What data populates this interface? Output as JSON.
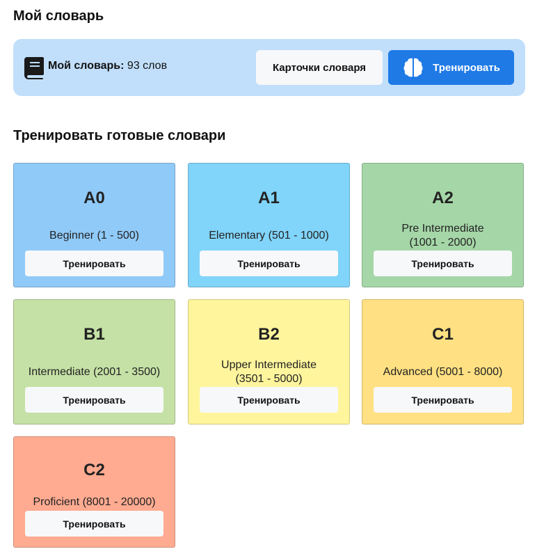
{
  "title": "Мой словарь",
  "my_dictionary": {
    "label_bold": "Мой словарь:",
    "count_text": "93 слов",
    "cards_button": "Карточки словаря",
    "train_button": "Тренировать"
  },
  "section_title": "Тренировать готовые словари",
  "levels": [
    {
      "code": "A0",
      "desc": "Beginner (1 - 500)",
      "button": "Тренировать",
      "color": "#90caf9"
    },
    {
      "code": "A1",
      "desc": "Elementary (501 - 1000)",
      "button": "Тренировать",
      "color": "#81d4fa"
    },
    {
      "code": "A2",
      "desc_line1": "Pre Intermediate",
      "desc_line2": "(1001 - 2000)",
      "button": "Тренировать",
      "color": "#a5d6a7"
    },
    {
      "code": "B1",
      "desc": "Intermediate (2001 - 3500)",
      "button": "Тренировать",
      "color": "#c5e1a5"
    },
    {
      "code": "B2",
      "desc_line1": "Upper Intermediate",
      "desc_line2": "(3501 - 5000)",
      "button": "Тренировать",
      "color": "#fff59d"
    },
    {
      "code": "C1",
      "desc": "Advanced (5001 - 8000)",
      "button": "Тренировать",
      "color": "#ffe082"
    },
    {
      "code": "C2",
      "desc": "Proficient (8001 - 20000)",
      "button": "Тренировать",
      "color": "#ffab91"
    }
  ],
  "icons": {
    "book": "book-icon",
    "brain": "brain-icon"
  }
}
